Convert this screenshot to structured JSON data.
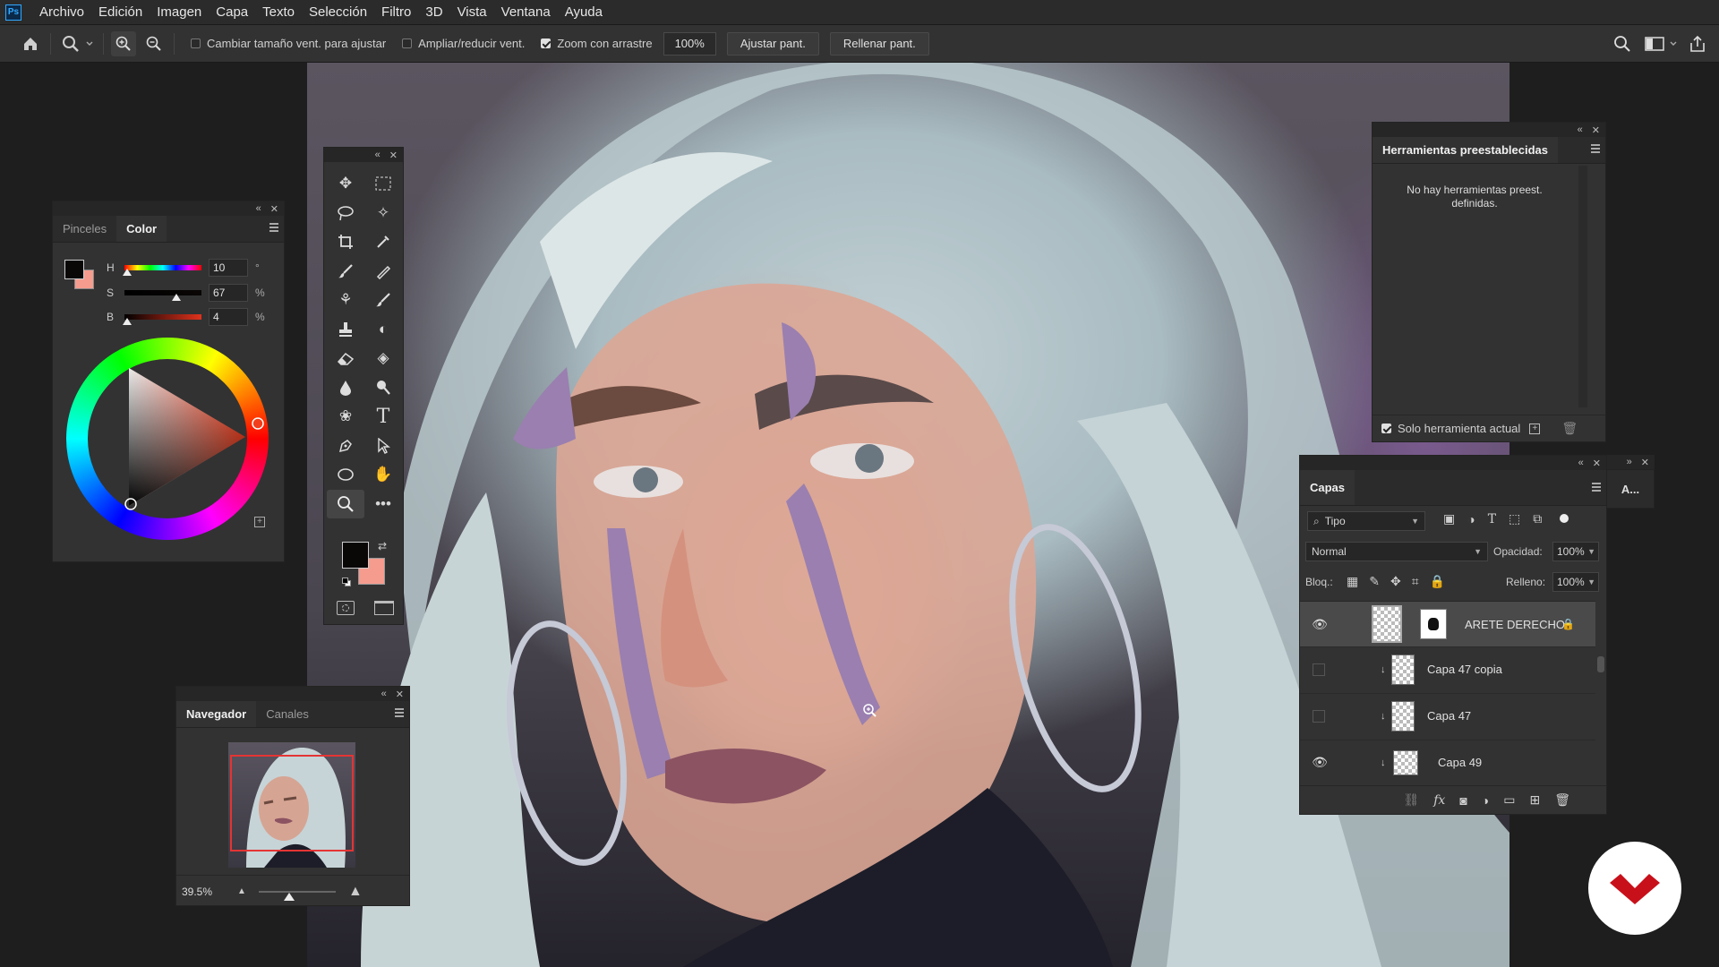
{
  "app": {
    "logo_text": "Ps"
  },
  "menu": [
    "Archivo",
    "Edición",
    "Imagen",
    "Capa",
    "Texto",
    "Selección",
    "Filtro",
    "3D",
    "Vista",
    "Ventana",
    "Ayuda"
  ],
  "options": {
    "resize_windows": "Cambiar tamaño vent. para ajustar",
    "zoom_all_windows": "Ampliar/reducir vent.",
    "scrubby_zoom": "Zoom con arrastre",
    "zoom_value": "100%",
    "fit_screen": "Ajustar pant.",
    "fill_screen": "Rellenar pant."
  },
  "color_panel": {
    "tabs": [
      "Pinceles",
      "Color"
    ],
    "h_label": "H",
    "h_value": "10",
    "h_unit": "°",
    "s_label": "S",
    "s_value": "67",
    "s_unit": "%",
    "b_label": "B",
    "b_value": "4",
    "b_unit": "%",
    "h_level": 0.03,
    "s_level": 0.67,
    "b_level": 0.04,
    "foreground": "#0a0707",
    "background": "#f59c8e"
  },
  "navigator": {
    "tabs": [
      "Navegador",
      "Canales"
    ],
    "zoom": "39.5%"
  },
  "presets": {
    "title": "Herramientas preestablecidas",
    "empty": "No hay herramientas preest. definidas.",
    "current_only": "Solo herramienta actual"
  },
  "layers": {
    "title": "Capas",
    "filter": "Tipo",
    "blend_mode": "Normal",
    "opacity_label": "Opacidad:",
    "opacity": "100%",
    "lock_label": "Bloq.:",
    "fill_label": "Relleno:",
    "fill": "100%",
    "items": [
      {
        "name": "ARETE DERECHO",
        "visible": true
      },
      {
        "name": "Capa 47 copia",
        "visible": false
      },
      {
        "name": "Capa 47",
        "visible": false
      },
      {
        "name": "Capa 49",
        "visible": true
      }
    ]
  },
  "collapsed_panel": {
    "label": "A..."
  },
  "accent": "#c8101a"
}
